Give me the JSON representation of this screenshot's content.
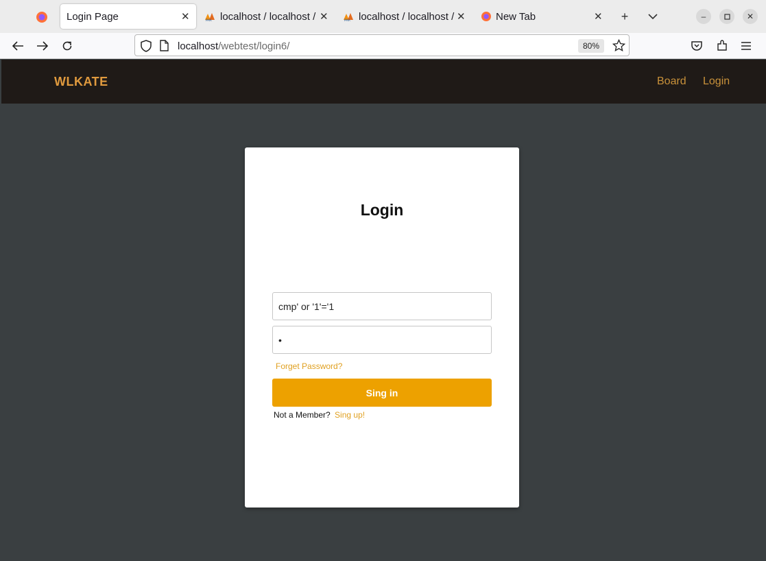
{
  "browser": {
    "tabs": [
      {
        "title": "Login Page",
        "active": true
      },
      {
        "title": "localhost / localhost / ",
        "active": false
      },
      {
        "title": "localhost / localhost / ",
        "active": false
      },
      {
        "title": "New Tab",
        "active": false
      }
    ],
    "url_host": "localhost",
    "url_path": "/webtest/login6/",
    "zoom": "80%"
  },
  "site": {
    "brand": "WLKATE",
    "nav": [
      "Board",
      "Login"
    ]
  },
  "login": {
    "title": "Login",
    "username_value": "cmp' or '1'='1",
    "password_value": "x",
    "forgot_label": "Forget Password?",
    "signin_label": "Sing in",
    "member_text": "Not a Member?",
    "signup_label": "Sing up!"
  },
  "colors": {
    "header_bg": "#1f1a17",
    "page_bg": "#3a3f41",
    "accent": "#eda100",
    "brand": "#e09a3e"
  }
}
